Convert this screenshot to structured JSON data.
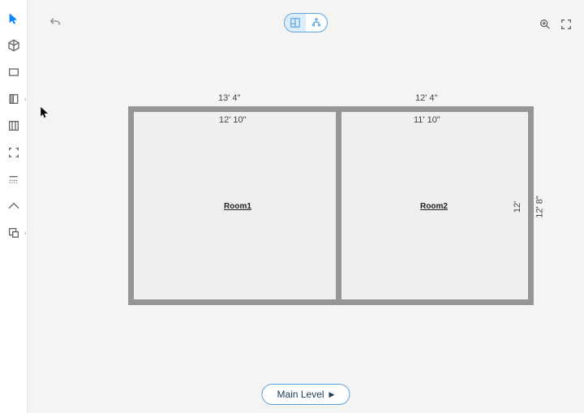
{
  "toolbar": {
    "tools": [
      {
        "name": "select-tool",
        "active": true
      },
      {
        "name": "cube-tool"
      },
      {
        "name": "rectangle-tool"
      },
      {
        "name": "wall-tool",
        "expandable": true
      },
      {
        "name": "column-tool"
      },
      {
        "name": "capture-tool"
      },
      {
        "name": "grid-tool"
      },
      {
        "name": "roof-tool"
      },
      {
        "name": "export-tool",
        "expandable": true
      }
    ]
  },
  "view_toggle": {
    "floorplan_active": true
  },
  "floorplan": {
    "rooms": [
      {
        "label": "Room1"
      },
      {
        "label": "Room2"
      }
    ],
    "dimensions": {
      "outer_left_width": "13' 4\"",
      "outer_right_width": "12' 4\"",
      "inner_left_width": "12' 10\"",
      "inner_right_width": "11' 10\"",
      "inner_height": "12'",
      "outer_height": "12' 8\""
    }
  },
  "level": {
    "label": "Main Level"
  }
}
